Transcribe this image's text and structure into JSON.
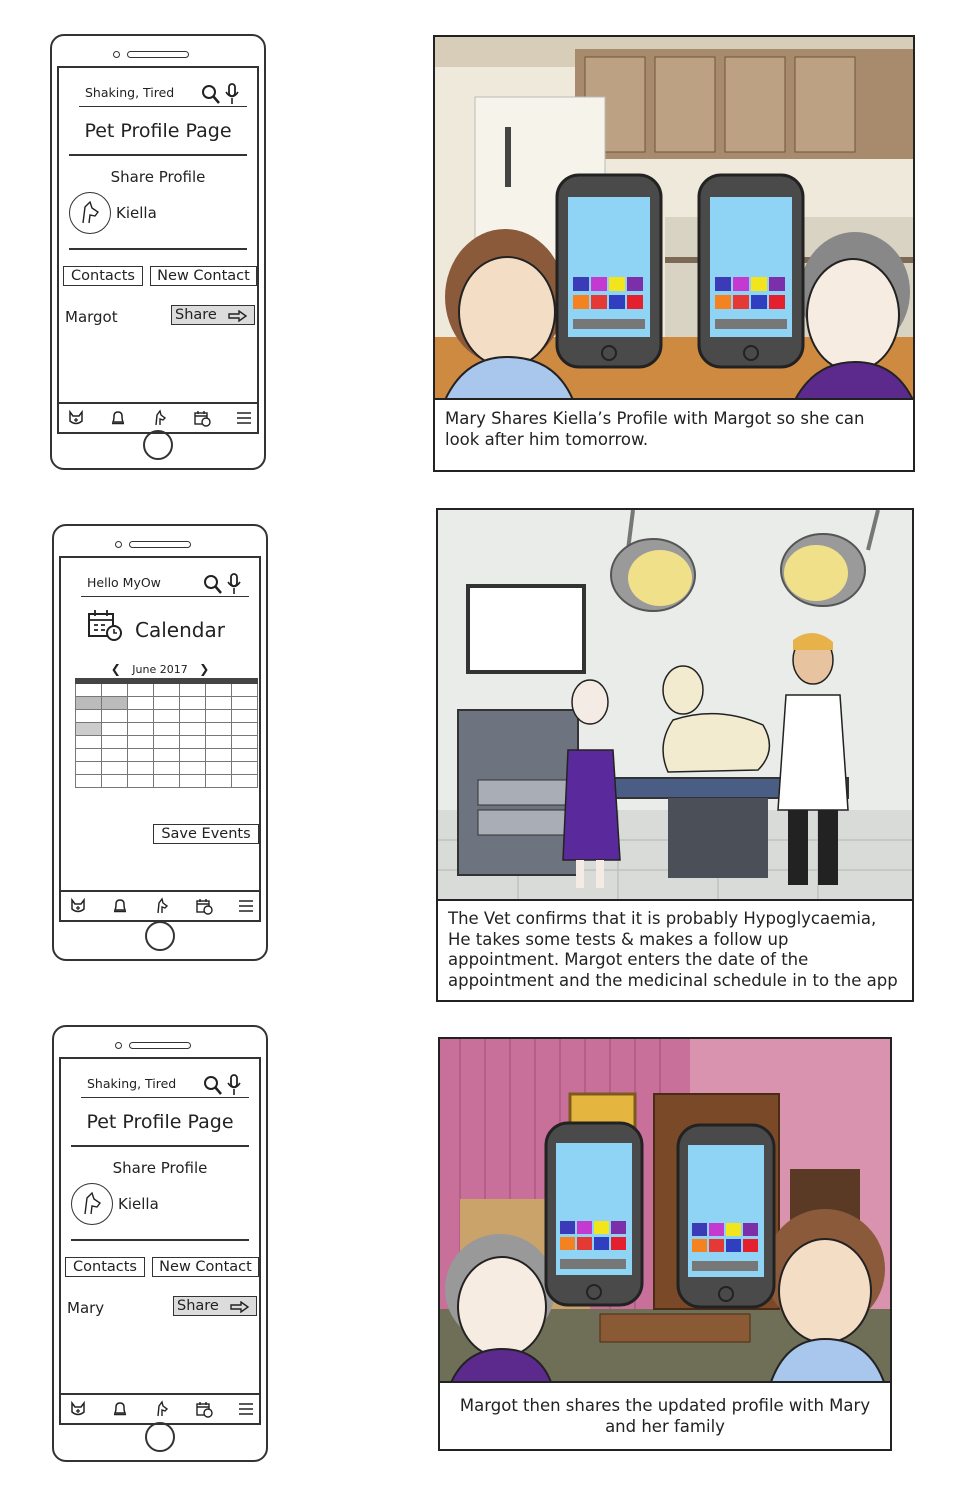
{
  "phone1": {
    "search": "Shaking, Tired",
    "title": "Pet Profile Page",
    "subtitle": "Share Profile",
    "pet_name": "Kiella",
    "contacts_label": "Contacts",
    "new_contact_label": "New Contact",
    "contact_name": "Margot",
    "share_label": "Share"
  },
  "panel1": {
    "caption": "Mary Shares Kiella’s Profile with Margot so she can look after him tomorrow."
  },
  "phone2": {
    "search": "Hello MyOw",
    "title": "Calendar",
    "month": "June 2017",
    "save_label": "Save Events"
  },
  "panel2": {
    "caption": "The Vet confirms that it is probably Hypoglycaemia, He takes some tests & makes a follow up appointment. Margot enters the date of the appointment and the medicinal schedule in to the app"
  },
  "phone3": {
    "search": "Shaking, Tired",
    "title": "Pet Profile Page",
    "subtitle": "Share Profile",
    "pet_name": "Kiella",
    "contacts_label": "Contacts",
    "new_contact_label": "New Contact",
    "contact_name": "Mary",
    "share_label": "Share"
  },
  "panel3": {
    "caption": "Margot then shares the updated profile with Mary and her family"
  },
  "colors": {
    "app_squares": [
      "#3b3bb8",
      "#c43ad0",
      "#f2e51c",
      "#7b2fa8",
      "#f58220",
      "#e53935",
      "#2f3fc0",
      "#e5202e"
    ],
    "phone_screen": "#8fd3f5"
  }
}
